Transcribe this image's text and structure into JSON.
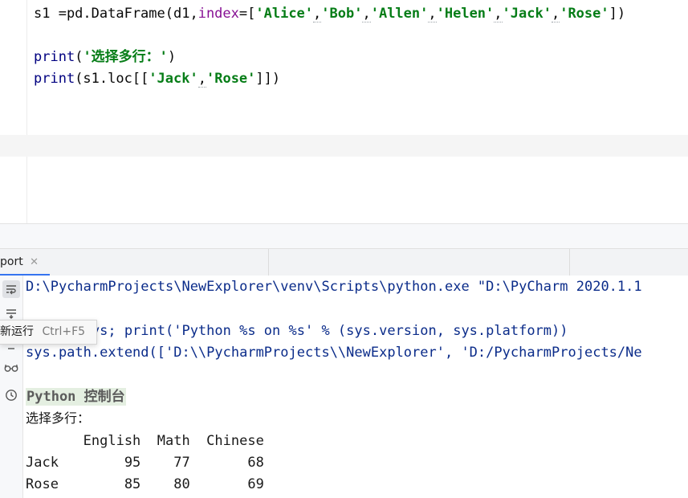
{
  "editor": {
    "lines": [
      {
        "id": "l1",
        "segments": [
          {
            "text": "s1 =pd.DataFrame(d1,",
            "cls": ""
          },
          {
            "text": "index",
            "cls": "kw-attr"
          },
          {
            "text": "=[",
            "cls": ""
          },
          {
            "text": "'Alice'",
            "cls": "str"
          },
          {
            "text": ",",
            "cls": "underline-mark"
          },
          {
            "text": "'Bob'",
            "cls": "str"
          },
          {
            "text": ",",
            "cls": "underline-mark"
          },
          {
            "text": "'Allen'",
            "cls": "str"
          },
          {
            "text": ",",
            "cls": "underline-mark"
          },
          {
            "text": "'Helen'",
            "cls": "str"
          },
          {
            "text": ",",
            "cls": "underline-mark"
          },
          {
            "text": "'Jack'",
            "cls": "str"
          },
          {
            "text": ",",
            "cls": "underline-mark"
          },
          {
            "text": "'Rose'",
            "cls": "str"
          },
          {
            "text": "])",
            "cls": ""
          }
        ]
      },
      {
        "id": "l2",
        "segments": []
      },
      {
        "id": "l3",
        "segments": [
          {
            "text": "print",
            "cls": "builtin"
          },
          {
            "text": "(",
            "cls": ""
          },
          {
            "text": "'选择多行：'",
            "cls": "str"
          },
          {
            "text": ")",
            "cls": ""
          }
        ]
      },
      {
        "id": "l4",
        "segments": [
          {
            "text": "print",
            "cls": "builtin"
          },
          {
            "text": "(s1.loc[[",
            "cls": ""
          },
          {
            "text": "'Jack'",
            "cls": "str"
          },
          {
            "text": ",",
            "cls": "underline-mark"
          },
          {
            "text": "'Rose'",
            "cls": "str"
          },
          {
            "text": "]])",
            "cls": ""
          }
        ]
      }
    ]
  },
  "run_tab": {
    "label": "port",
    "close_glyph": "✕"
  },
  "tooltip": {
    "label": "新运行",
    "shortcut": "Ctrl+F5"
  },
  "console": {
    "lines": [
      "D:\\PycharmProjects\\NewExplorer\\venv\\Scripts\\python.exe \"D:\\PyCharm 2020.1.1",
      "",
      "import sys; print('Python %s on %s' % (sys.version, sys.platform))",
      "sys.path.extend(['D:\\\\PycharmProjects\\\\NewExplorer', 'D:/PycharmProjects/Ne",
      "",
      "Python 控制台",
      "选择多行：",
      "       English  Math  Chinese",
      "Jack        95    77       68",
      "Rose        85    80       69"
    ]
  },
  "gutter_icons": [
    "soft-wrap-icon",
    "scroll-to-end-icon",
    "rerun-icon",
    "glasses-icon",
    "history-clock-icon"
  ]
}
